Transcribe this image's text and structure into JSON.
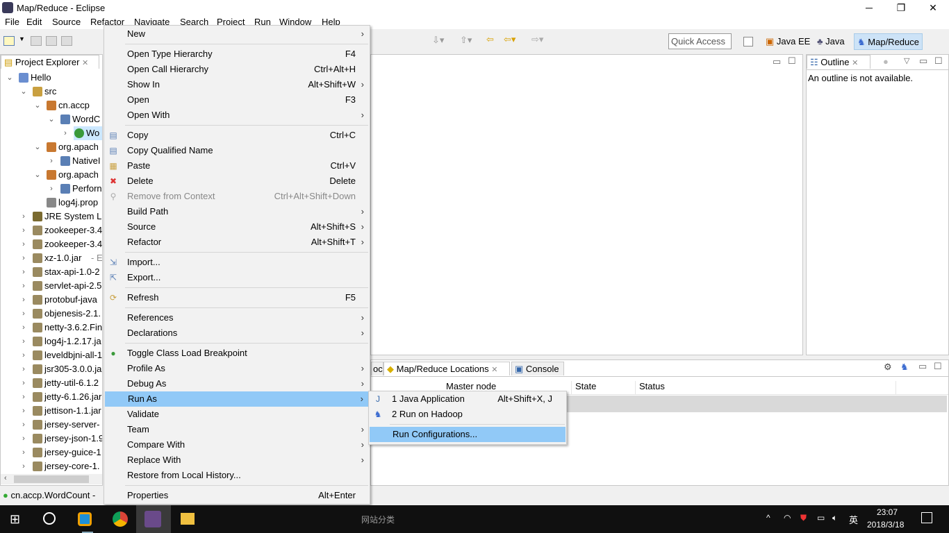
{
  "window": {
    "title": "Map/Reduce - Eclipse",
    "minimize": "─",
    "restore": "❐",
    "close": "✕"
  },
  "menubar": [
    "File",
    "Edit",
    "Source",
    "Refactor",
    "Navigate",
    "Search",
    "Project",
    "Run",
    "Window",
    "Help"
  ],
  "toolbar": {
    "quick_access_placeholder": "Quick Access",
    "perspectives": [
      "Java EE",
      "Java",
      "Map/Reduce"
    ],
    "active_perspective": "Map/Reduce"
  },
  "project_explorer": {
    "tab": "Project Explorer",
    "tree": [
      {
        "label": "Hello",
        "level": 0,
        "exp": "open",
        "icon": "project"
      },
      {
        "label": "src",
        "level": 1,
        "exp": "open",
        "icon": "srcfolder"
      },
      {
        "label": "cn.accp",
        "level": 2,
        "exp": "open",
        "icon": "package"
      },
      {
        "label": "WordC",
        "level": 3,
        "exp": "open",
        "icon": "javafile"
      },
      {
        "label": "Wo",
        "level": 4,
        "exp": "closed",
        "icon": "class",
        "selected": true
      },
      {
        "label": "org.apach",
        "level": 2,
        "exp": "open",
        "icon": "package"
      },
      {
        "label": "NativeI",
        "level": 3,
        "exp": "closed",
        "icon": "javafile"
      },
      {
        "label": "org.apach",
        "level": 2,
        "exp": "open",
        "icon": "package"
      },
      {
        "label": "Perforn",
        "level": 3,
        "exp": "closed",
        "icon": "javafile"
      },
      {
        "label": "log4j.prop",
        "level": 2,
        "exp": "none",
        "icon": "file"
      },
      {
        "label": "JRE System Lil",
        "level": 1,
        "exp": "closed",
        "icon": "library"
      },
      {
        "label": "zookeeper-3.4",
        "level": 1,
        "exp": "closed",
        "icon": "jar"
      },
      {
        "label": "zookeeper-3.4",
        "level": 1,
        "exp": "closed",
        "icon": "jar"
      },
      {
        "label": "xz-1.0.jar",
        "suffix": " - E:\\",
        "level": 1,
        "exp": "closed",
        "icon": "jar"
      },
      {
        "label": "stax-api-1.0-2",
        "level": 1,
        "exp": "closed",
        "icon": "jar"
      },
      {
        "label": "servlet-api-2.5",
        "level": 1,
        "exp": "closed",
        "icon": "jar"
      },
      {
        "label": "protobuf-java",
        "level": 1,
        "exp": "closed",
        "icon": "jar"
      },
      {
        "label": "objenesis-2.1.",
        "level": 1,
        "exp": "closed",
        "icon": "jar"
      },
      {
        "label": "netty-3.6.2.Fin",
        "level": 1,
        "exp": "closed",
        "icon": "jar"
      },
      {
        "label": "log4j-1.2.17.ja",
        "level": 1,
        "exp": "closed",
        "icon": "jar"
      },
      {
        "label": "leveldbjni-all-1",
        "level": 1,
        "exp": "closed",
        "icon": "jar"
      },
      {
        "label": "jsr305-3.0.0.ja",
        "level": 1,
        "exp": "closed",
        "icon": "jar"
      },
      {
        "label": "jetty-util-6.1.2",
        "level": 1,
        "exp": "closed",
        "icon": "jar"
      },
      {
        "label": "jetty-6.1.26.jar",
        "level": 1,
        "exp": "closed",
        "icon": "jar"
      },
      {
        "label": "jettison-1.1.jar",
        "level": 1,
        "exp": "closed",
        "icon": "jar"
      },
      {
        "label": "jersey-server-",
        "level": 1,
        "exp": "closed",
        "icon": "jar"
      },
      {
        "label": "jersey-json-1.9",
        "level": 1,
        "exp": "closed",
        "icon": "jar"
      },
      {
        "label": "jersey-guice-1",
        "level": 1,
        "exp": "closed",
        "icon": "jar"
      },
      {
        "label": "jersey-core-1.",
        "level": 1,
        "exp": "closed",
        "icon": "jar"
      }
    ]
  },
  "status_bar": {
    "text": "cn.accp.WordCount -"
  },
  "outline": {
    "tab": "Outline",
    "message": "An outline is not available."
  },
  "bottom_panel": {
    "tabs": [
      "oc",
      "Map/Reduce Locations",
      "Console"
    ],
    "active_tab": "Map/Reduce Locations",
    "columns": [
      "Master node",
      "State",
      "Status"
    ]
  },
  "context_menu": [
    {
      "label": "New",
      "arrow": true
    },
    {
      "sep": true
    },
    {
      "label": "Open Type Hierarchy",
      "shortcut": "F4"
    },
    {
      "label": "Open Call Hierarchy",
      "shortcut": "Ctrl+Alt+H"
    },
    {
      "label": "Show In",
      "shortcut": "Alt+Shift+W",
      "arrow": true
    },
    {
      "label": "Open",
      "shortcut": "F3"
    },
    {
      "label": "Open With",
      "arrow": true
    },
    {
      "sep": true
    },
    {
      "label": "Copy",
      "shortcut": "Ctrl+C",
      "icon": "copy"
    },
    {
      "label": "Copy Qualified Name",
      "icon": "copy-qualified"
    },
    {
      "label": "Paste",
      "shortcut": "Ctrl+V",
      "icon": "paste"
    },
    {
      "label": "Delete",
      "shortcut": "Delete",
      "icon": "delete"
    },
    {
      "label": "Remove from Context",
      "shortcut": "Ctrl+Alt+Shift+Down",
      "disabled": true,
      "icon": "remove-context"
    },
    {
      "label": "Build Path",
      "arrow": true
    },
    {
      "label": "Source",
      "shortcut": "Alt+Shift+S",
      "arrow": true
    },
    {
      "label": "Refactor",
      "shortcut": "Alt+Shift+T",
      "arrow": true
    },
    {
      "sep": true
    },
    {
      "label": "Import...",
      "icon": "import"
    },
    {
      "label": "Export...",
      "icon": "export"
    },
    {
      "sep": true
    },
    {
      "label": "Refresh",
      "shortcut": "F5",
      "icon": "refresh"
    },
    {
      "sep": true
    },
    {
      "label": "References",
      "arrow": true
    },
    {
      "label": "Declarations",
      "arrow": true
    },
    {
      "sep": true
    },
    {
      "label": "Toggle Class Load Breakpoint",
      "icon": "breakpoint"
    },
    {
      "label": "Profile As",
      "arrow": true
    },
    {
      "label": "Debug As",
      "arrow": true
    },
    {
      "label": "Run As",
      "arrow": true,
      "highlight": true
    },
    {
      "label": "Validate"
    },
    {
      "label": "Team",
      "arrow": true
    },
    {
      "label": "Compare With",
      "arrow": true
    },
    {
      "label": "Replace With",
      "arrow": true
    },
    {
      "label": "Restore from Local History..."
    },
    {
      "sep": true
    },
    {
      "label": "Properties",
      "shortcut": "Alt+Enter"
    }
  ],
  "run_as_submenu": [
    {
      "label": "1 Java Application",
      "shortcut": "Alt+Shift+X, J",
      "icon": "java-app"
    },
    {
      "label": "2 Run on Hadoop",
      "icon": "hadoop-elephant"
    },
    {
      "sep": true
    },
    {
      "label": "Run Configurations...",
      "highlight": true
    }
  ],
  "taskbar": {
    "search_text": "网站分类",
    "ime": "英",
    "time": "23:07",
    "date": "2018/3/18"
  },
  "colors": {
    "highlight": "#91c9f7",
    "perspective_active": "#cde3f7",
    "taskbar": "#101010"
  }
}
